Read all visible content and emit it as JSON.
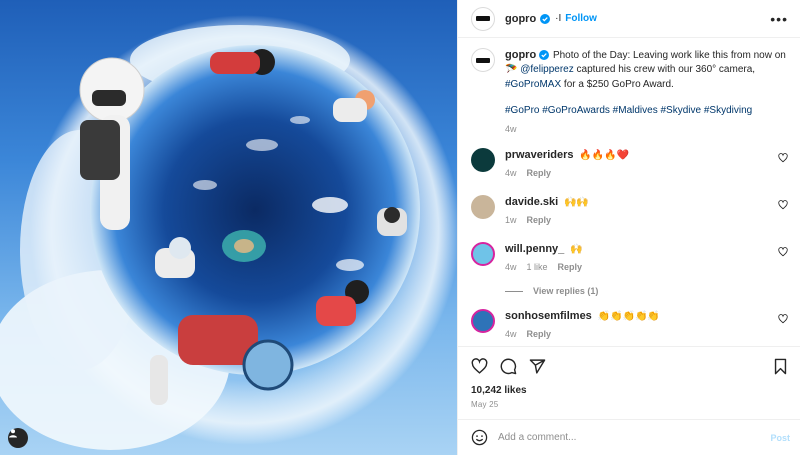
{
  "post": {
    "username": "gopro",
    "dot_sep": "·I",
    "follow_label": "Follow",
    "more_label": "•••",
    "caption": {
      "username": "gopro",
      "line1": " Photo of the Day: Leaving work like this from now on",
      "emoji": "🪂",
      "mention": "@felipperez",
      "line2": " captured his crew with our 360° camera,",
      "tag_camera": "#GoProMAX",
      "line3": " for a $250 GoPro Award.",
      "hashtags": [
        "#GoPro",
        "#GoProAwards",
        "#Maldives",
        "#Skydive",
        "#Skydiving"
      ],
      "age": "4w"
    },
    "comments": [
      {
        "username": "prwaveriders",
        "text": "🔥🔥🔥❤️",
        "age": "4w",
        "likes": "",
        "reply": "Reply",
        "avatar_color": "#0b3a3c"
      },
      {
        "username": "davide.ski",
        "text": "🙌🙌",
        "age": "1w",
        "likes": "",
        "reply": "Reply",
        "avatar_color": "#c9b59a"
      },
      {
        "username": "will.penny_",
        "text": "🙌",
        "age": "4w",
        "likes": "1 like",
        "reply": "Reply",
        "avatar_color": "#6fc3e8"
      },
      {
        "username": "sonhosemfilmes",
        "text": "👏👏👏👏👏",
        "age": "4w",
        "likes": "",
        "reply": "Reply",
        "avatar_color": "#2e73b8"
      }
    ],
    "view_replies": "View replies (1)",
    "likes_count": "10,242 likes",
    "date": "May 25",
    "add_comment_placeholder": "Add a comment...",
    "post_label": "Post"
  },
  "icons": {
    "verified": "verified-badge-icon",
    "heart": "heart-icon",
    "comment": "comment-icon",
    "share": "share-icon",
    "bookmark": "bookmark-icon",
    "emoji": "emoji-icon",
    "user_tag": "user-tag-icon"
  },
  "colors": {
    "accent": "#0095f6",
    "link": "#00376b",
    "muted": "#8e8e8e",
    "post_disabled": "#b2dffc"
  }
}
